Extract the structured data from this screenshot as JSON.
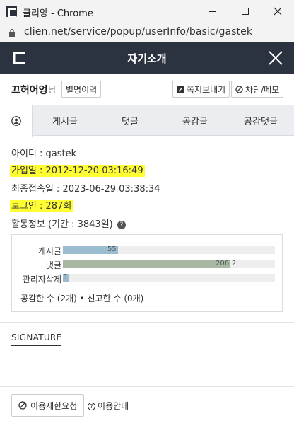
{
  "window": {
    "title": "클리앙 - Chrome",
    "url": "clien.net/service/popup/userInfo/basic/gastek"
  },
  "header": {
    "title": "자기소개"
  },
  "user": {
    "nickname": "끄허어엉",
    "suffix": "님",
    "history_button": "별명이력",
    "message_button": "쪽지보내기",
    "block_button": "차단/메모"
  },
  "tabs": {
    "posts": "게시글",
    "comments": "댓글",
    "likes": "공감글",
    "like_comments": "공감댓글"
  },
  "info": {
    "id": "아이디 : gastek",
    "joined": "가입일 : 2012-12-20 03:16:49",
    "last_login": "최종접속일 : 2023-06-29 03:38:34",
    "login_count": "로그인 : 287회",
    "activity": "활동정보 (기간 : 3843일)"
  },
  "stats": {
    "rows": [
      {
        "label": "게시글",
        "value": "55",
        "fraction": 0.26
      },
      {
        "label": "댓글",
        "value": "206",
        "value2": "2",
        "fraction": 0.79
      },
      {
        "label": "관리자삭제",
        "value": "1",
        "fraction": 0.03
      }
    ],
    "summary": "공감한 수 (2개) • 신고한 수 (0개)",
    "colors": {
      "posts": "#9bbdd0",
      "comments": "#a9b8a2",
      "deleted": "#9bbdd0"
    }
  },
  "signature": {
    "label": "SIGNATURE"
  },
  "footer": {
    "restrict_button": "이용제한요청",
    "guide_link": "이용안내"
  }
}
